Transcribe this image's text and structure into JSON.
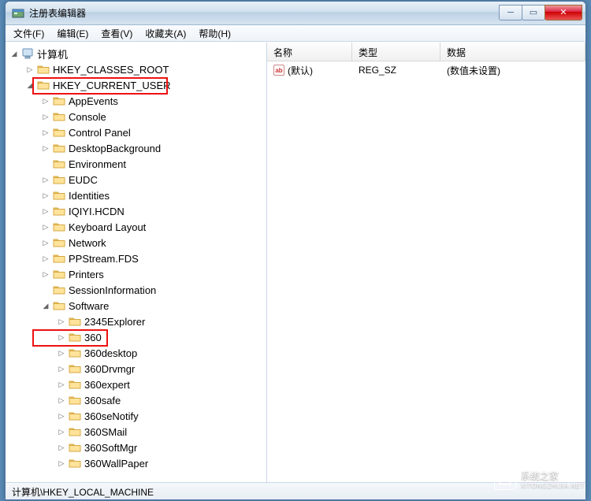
{
  "window": {
    "title": "注册表编辑器"
  },
  "menus": [
    {
      "label": "文件(F)"
    },
    {
      "label": "编辑(E)"
    },
    {
      "label": "查看(V)"
    },
    {
      "label": "收藏夹(A)"
    },
    {
      "label": "帮助(H)"
    }
  ],
  "columns": {
    "name": "名称",
    "type": "类型",
    "data": "数据"
  },
  "values": [
    {
      "icon": "ab",
      "name": "(默认)",
      "type": "REG_SZ",
      "data": "(数值未设置)"
    }
  ],
  "tree": {
    "root": {
      "label": "计算机",
      "expanded": true
    },
    "keys": [
      {
        "label": "HKEY_CLASSES_ROOT",
        "depth": 1,
        "exp": "closed"
      },
      {
        "label": "HKEY_CURRENT_USER",
        "depth": 1,
        "exp": "open",
        "hl": 1
      },
      {
        "label": "AppEvents",
        "depth": 2,
        "exp": "closed"
      },
      {
        "label": "Console",
        "depth": 2,
        "exp": "closed"
      },
      {
        "label": "Control Panel",
        "depth": 2,
        "exp": "closed"
      },
      {
        "label": "DesktopBackground",
        "depth": 2,
        "exp": "closed"
      },
      {
        "label": "Environment",
        "depth": 2,
        "exp": "none"
      },
      {
        "label": "EUDC",
        "depth": 2,
        "exp": "closed"
      },
      {
        "label": "Identities",
        "depth": 2,
        "exp": "closed"
      },
      {
        "label": "IQIYI.HCDN",
        "depth": 2,
        "exp": "closed"
      },
      {
        "label": "Keyboard Layout",
        "depth": 2,
        "exp": "closed"
      },
      {
        "label": "Network",
        "depth": 2,
        "exp": "closed"
      },
      {
        "label": "PPStream.FDS",
        "depth": 2,
        "exp": "closed"
      },
      {
        "label": "Printers",
        "depth": 2,
        "exp": "closed"
      },
      {
        "label": "SessionInformation",
        "depth": 2,
        "exp": "none"
      },
      {
        "label": "Software",
        "depth": 2,
        "exp": "open",
        "hl": 2
      },
      {
        "label": "2345Explorer",
        "depth": 3,
        "exp": "closed"
      },
      {
        "label": "360",
        "depth": 3,
        "exp": "closed"
      },
      {
        "label": "360desktop",
        "depth": 3,
        "exp": "closed"
      },
      {
        "label": "360Drvmgr",
        "depth": 3,
        "exp": "closed"
      },
      {
        "label": "360expert",
        "depth": 3,
        "exp": "closed"
      },
      {
        "label": "360safe",
        "depth": 3,
        "exp": "closed"
      },
      {
        "label": "360seNotify",
        "depth": 3,
        "exp": "closed"
      },
      {
        "label": "360SMail",
        "depth": 3,
        "exp": "closed"
      },
      {
        "label": "360SoftMgr",
        "depth": 3,
        "exp": "closed"
      },
      {
        "label": "360WallPaper",
        "depth": 3,
        "exp": "closed"
      }
    ]
  },
  "statusbar": "计算机\\HKEY_LOCAL_MACHINE",
  "watermark": {
    "big": "系统之家",
    "small": "XITONGZHIJIA.NET"
  }
}
